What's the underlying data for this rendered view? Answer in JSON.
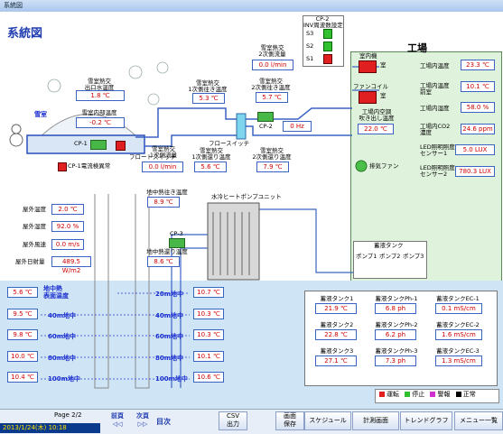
{
  "window": {
    "title": "系統図"
  },
  "screen_title": "系統図",
  "factory_title": "工場",
  "snow_room": {
    "label": "雪室"
  },
  "labels": {
    "snow_hx_out_temp": "雪室熱交\n出口水温度",
    "snow_room_temp": "雪室内部温度",
    "cp1": "CP-1",
    "float_switch": "フロートスイッチ",
    "cp1_power": "CP-1電流検異常",
    "hx2_flow": "雪室熱交\n2次側流量",
    "hx1_in_temp": "雪室熱交\n1次側往き温度",
    "hx2_in_temp": "雪室熱交\n2次側往き温度",
    "flow_switch": "フロースイッチ",
    "cp2": "CP-2",
    "hx1_flow": "雪室熱交\n1次側流量",
    "hx1_ret_temp": "雪室熱交\n1次側還り温度",
    "hx2_ret_temp": "雪室熱交\n2次側還り温度",
    "inv": "CP-2\nINV周波数設定",
    "s1": "S1",
    "s2": "S2",
    "s3": "S3",
    "outdoor_unit": "室内機",
    "fan_coil": "ファンコイル",
    "blow_temp": "工場内空調\n吹き出し温度",
    "exhaust_fan": "排気ファン",
    "factory_temp": "工場内温度",
    "factory_temp2": "工場内温度\n前室",
    "factory_humidity": "工場内湿度",
    "factory_co2": "工場内CO2\n濃度",
    "led1": "LED照明照度\nセンサー1",
    "led2": "LED照明照度\nセンサー2",
    "room_label1": "室",
    "room_label2": "室",
    "geo_supply": "地中熱往き温度",
    "geo_return": "地中熱還り温度",
    "heatpump": "水冷ヒートポンプユニット",
    "cp3": "CP-3",
    "outdoor_temp": "屋外温度",
    "outdoor_humidity": "屋外湿度",
    "wind_speed": "屋外風速",
    "solar": "屋外日射量",
    "ground_surface": "地中熱\n表面温度",
    "depth20": "20m地中",
    "depth40": "40m地中",
    "depth60": "60m地中",
    "depth80": "80m地中",
    "depth100": "100m地中",
    "storage_tank": "蓄液タンク",
    "pump1": "ポンプ1",
    "pump2": "ポンプ2",
    "pump3": "ポンプ3"
  },
  "values": {
    "snow_hx_out_temp": "1.8 ℃",
    "snow_room_temp": "-0.2 ℃",
    "hx2_flow": "0.0 l/min",
    "hx1_in_temp": "5.3 ℃",
    "hx2_in_temp": "5.7 ℃",
    "inv_hz": "0 Hz",
    "hx1_flow": "0.0 l/min",
    "hx1_ret_temp": "5.6 ℃",
    "hx2_ret_temp": "7.9 ℃",
    "blow_temp": "22.0 ℃",
    "factory_temp": "23.3 ℃",
    "factory_temp2": "10.1 ℃",
    "factory_humidity": "58.0 %",
    "factory_co2": "24.6 ppm",
    "led1": "5.0 LUX",
    "led2": "780.3 LUX",
    "geo_supply": "8.9 ℃",
    "geo_return": "8.6 ℃",
    "outdoor_temp": "2.0 ℃",
    "outdoor_humidity": "92.0 %",
    "wind_speed": "0.0 m/s",
    "solar": "489.5 W/m2",
    "ground_surface": "5.6 ℃",
    "left_40": "9.5 ℃",
    "left_60": "9.8 ℃",
    "left_80": "10.0 ℃",
    "left_100": "10.4 ℃",
    "right_20": "10.7 ℃",
    "right_40": "10.3 ℃",
    "right_60": "10.3 ℃",
    "right_80": "10.1 ℃",
    "right_100": "10.6 ℃"
  },
  "tanks": [
    {
      "label": "蓄液タンク1",
      "value": "21.9 ℃"
    },
    {
      "label": "蓄液タンクPh-1",
      "value": "6.8 ph"
    },
    {
      "label": "蓄液タンクEC-1",
      "value": "0.1 mS/cm"
    },
    {
      "label": "蓄液タンク2",
      "value": "22.8 ℃"
    },
    {
      "label": "蓄液タンクPh-2",
      "value": "6.2 ph"
    },
    {
      "label": "蓄液タンクEC-2",
      "value": "1.6 mS/cm"
    },
    {
      "label": "蓄液タンク3",
      "value": "27.1 ℃"
    },
    {
      "label": "蓄液タンクPh-3",
      "value": "7.3 ph"
    },
    {
      "label": "蓄液タンクEC-3",
      "value": "1.3 mS/cm"
    }
  ],
  "legend": {
    "run": "運転",
    "stop": "停止",
    "alarm": "警報",
    "normal": "正常"
  },
  "colors": {
    "run": "#e02020",
    "stop": "#30c030",
    "alarm": "#d030d0",
    "normal": "#000000",
    "value_text": "#d00000",
    "accent": "#1f3db0"
  },
  "footer": {
    "page": "Page 2/2",
    "datetime": "2013/1/24(木) 10:18",
    "prev": "前頁",
    "next": "次頁",
    "prev_arrows": "◁◁",
    "next_arrows": "▷▷",
    "index": "目次",
    "csv": "CSV\n出力",
    "screen_save": "画面\n保存",
    "schedule": "スケジュール",
    "measure": "計測画面",
    "trend": "トレンドグラフ",
    "menu": "メニュー一覧"
  }
}
